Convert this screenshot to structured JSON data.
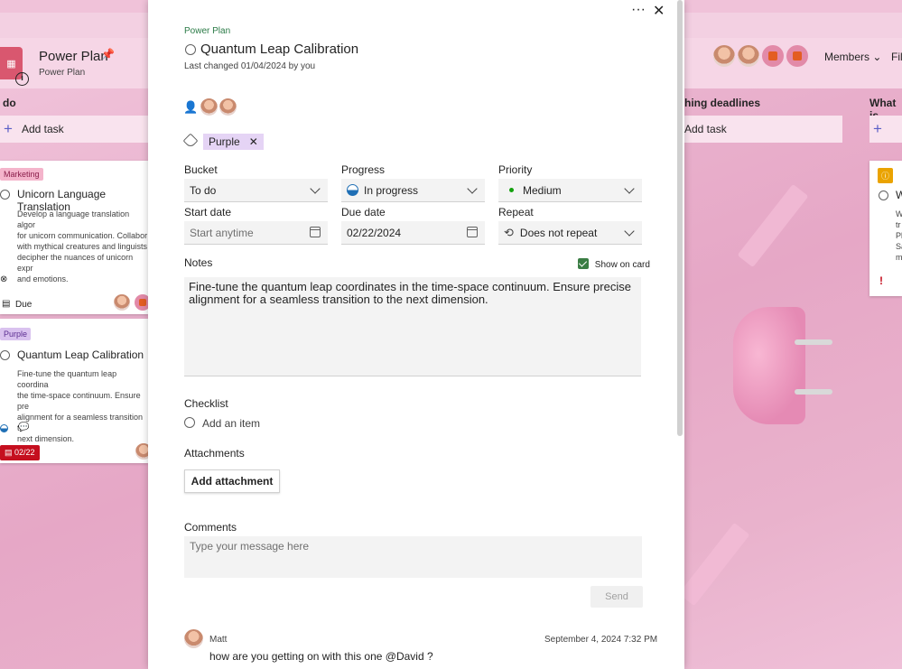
{
  "board": {
    "plan_title": "Power Plan",
    "plan_subtitle": "Power Plan",
    "members_label": "Members",
    "filter_label": "Filt",
    "columns": [
      {
        "title": "do",
        "add_task": "Add task"
      },
      {
        "title": "hing deadlines",
        "add_task": "Add task"
      },
      {
        "title": "What is",
        "add_task": ""
      }
    ],
    "cards": [
      {
        "label": "Marketing",
        "title": "Unicorn Language Translation",
        "body": [
          "Develop a language translation algor",
          "for unicorn communication. Collabor",
          "with mythical creatures and linguists",
          "decipher the nuances of unicorn expr",
          "and emotions."
        ],
        "due": "Due"
      },
      {
        "label": "Purple",
        "title": "Quantum Leap Calibration",
        "body": [
          "Fine-tune the quantum leap coordina",
          "the time-space continuum. Ensure pre",
          "alignment for a seamless transition to",
          "next dimension."
        ],
        "due": "02/22"
      }
    ],
    "right_card": {
      "title": "W",
      "body": [
        "W",
        "tr",
        "Pl",
        "Sa",
        "m"
      ]
    }
  },
  "task": {
    "plan_name": "Power Plan",
    "title": "Quantum Leap Calibration",
    "last_changed": "Last changed 01/04/2024 by you",
    "label": "Purple",
    "bucket": {
      "label": "Bucket",
      "value": "To do"
    },
    "progress": {
      "label": "Progress",
      "value": "In progress"
    },
    "priority": {
      "label": "Priority",
      "value": "Medium"
    },
    "start_date": {
      "label": "Start date",
      "placeholder": "Start anytime"
    },
    "due_date": {
      "label": "Due date",
      "value": "02/22/2024"
    },
    "repeat": {
      "label": "Repeat",
      "value": "Does not repeat"
    },
    "notes": {
      "label": "Notes",
      "show_on_card": "Show on card",
      "text": "Fine-tune the quantum leap coordinates in the time-space continuum. Ensure precise alignment for a seamless transition to the next dimension."
    },
    "checklist": {
      "label": "Checklist",
      "add_item": "Add an item"
    },
    "attachments": {
      "label": "Attachments",
      "button": "Add attachment"
    },
    "comments": {
      "label": "Comments",
      "placeholder": "Type your message here",
      "send": "Send",
      "items": [
        {
          "author": "Matt",
          "timestamp": "September 4, 2024 7:32 PM",
          "text": "how are you getting on with this one @David ?"
        }
      ]
    }
  },
  "colors": {
    "accent_green": "#3a7d44",
    "label_purple": "#e5d4f5",
    "due_red": "#c50f1f"
  }
}
